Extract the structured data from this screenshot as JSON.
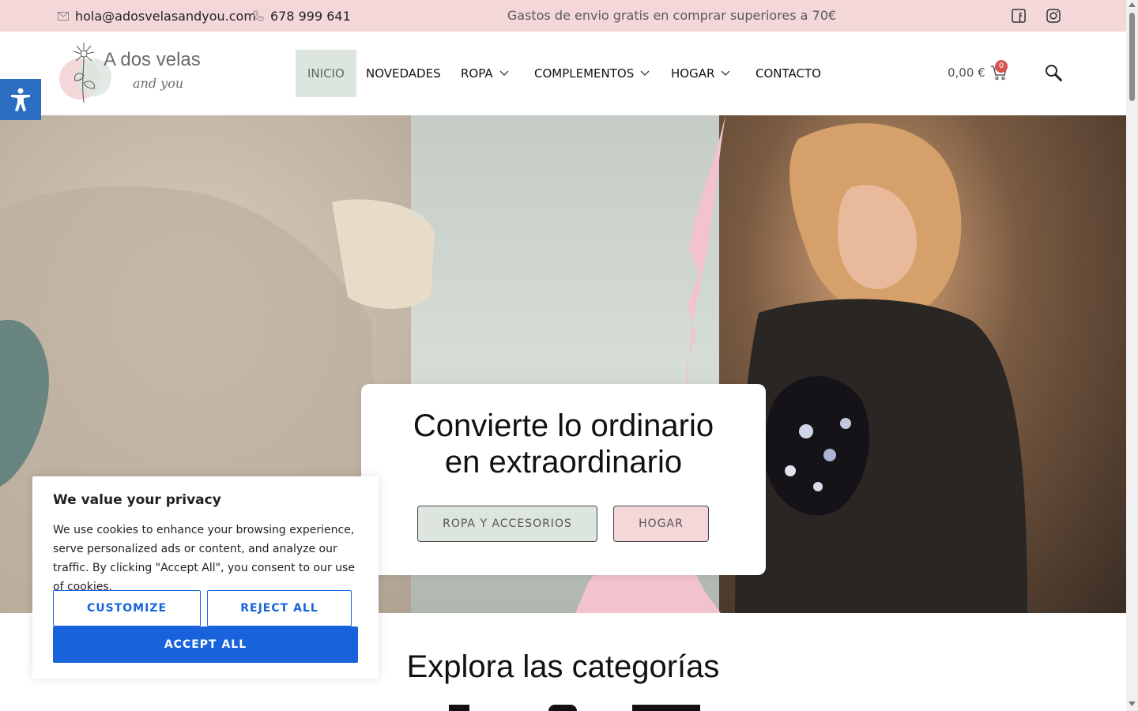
{
  "topbar": {
    "email": "hola@adosvelasandyou.com",
    "phone": "678 999 641",
    "promo": "Gastos de envio gratis en comprar superiores a 70€",
    "social": [
      "facebook-icon",
      "instagram-icon"
    ]
  },
  "logo": {
    "title": "A dos velas",
    "subtitle": "and you"
  },
  "nav": {
    "items": [
      {
        "label": "INICIO",
        "active": true
      },
      {
        "label": "NOVEDADES"
      },
      {
        "label": "ROPA",
        "dropdown": true
      },
      {
        "label": "COMPLEMENTOS",
        "dropdown": true
      },
      {
        "label": "HOGAR",
        "dropdown": true
      },
      {
        "label": "CONTACTO"
      }
    ]
  },
  "cart": {
    "total": "0,00 €",
    "count": "0"
  },
  "hero": {
    "title_line1": "Convierte lo ordinario",
    "title_line2": "en extraordinario",
    "btn_ropa": "ROPA Y ACCESORIOS",
    "btn_hogar": "HOGAR"
  },
  "section": {
    "title": "Explora las categorías"
  },
  "cookie": {
    "title": "We value your privacy",
    "text": "We use cookies to enhance your browsing experience, serve personalized ads or content, and analyze our traffic. By clicking \"Accept All\", you consent to our use of cookies.",
    "customize": "CUSTOMIZE",
    "reject": "REJECT ALL",
    "accept": "ACCEPT ALL"
  },
  "colors": {
    "pink": "#f4d7d8",
    "sage": "#dce6df",
    "accent_blue": "#1863dc",
    "a11y_blue": "#2b6dc1"
  }
}
